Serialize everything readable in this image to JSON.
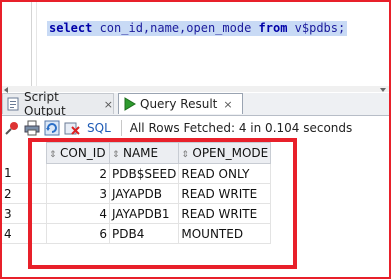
{
  "editor": {
    "sql_select": "select",
    "sql_columns": " con_id,name,open_mode ",
    "sql_from": "from",
    "sql_rest": " v$pdbs;"
  },
  "tabs": [
    {
      "label": "Script Output",
      "icon": "script-output-icon",
      "close": "×"
    },
    {
      "label": "Query Result",
      "icon": "run-icon",
      "close": "×"
    }
  ],
  "toolbar": {
    "sql_label": "SQL",
    "separator": "|",
    "status": "All Rows Fetched: 4 in 0.104 seconds"
  },
  "grid": {
    "columns": [
      "CON_ID",
      "NAME",
      "OPEN_MODE"
    ],
    "rows": [
      {
        "rownum": "1",
        "con_id": "2",
        "name": "PDB$SEED",
        "open_mode": "READ ONLY"
      },
      {
        "rownum": "2",
        "con_id": "3",
        "name": "JAYAPDB",
        "open_mode": "READ WRITE"
      },
      {
        "rownum": "3",
        "con_id": "4",
        "name": "JAYAPDB1",
        "open_mode": "READ WRITE"
      },
      {
        "rownum": "4",
        "con_id": "6",
        "name": "PDB4",
        "open_mode": "MOUNTED"
      }
    ]
  },
  "colors": {
    "highlight": "#e8202a",
    "selection": "#c8daf5",
    "keyword": "#0000a8"
  }
}
